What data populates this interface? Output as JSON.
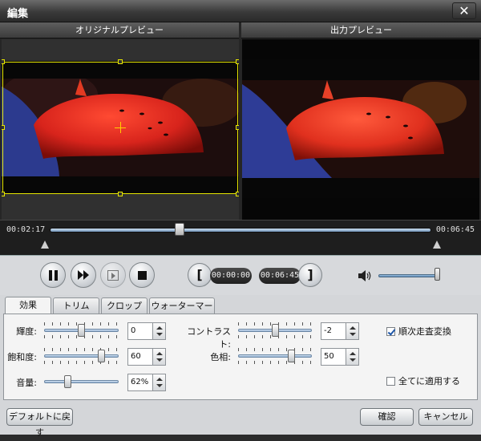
{
  "window": {
    "title": "編集",
    "close_label": "✕"
  },
  "preview": {
    "original_label": "オリジナルプレビュー",
    "output_label": "出力プレビュー"
  },
  "timeline": {
    "start_time": "00:02:17",
    "end_time": "00:06:45",
    "position_fraction": 0.34
  },
  "playback": {
    "trim_start": "00:00:00",
    "trim_end": "00:06:45",
    "volume_fraction": 0.95,
    "open_bracket": "[",
    "close_bracket": "]"
  },
  "tabs": [
    {
      "label": "効果",
      "active": true
    },
    {
      "label": "トリム",
      "active": false
    },
    {
      "label": "クロップ",
      "active": false
    },
    {
      "label": "ウォーターマーク",
      "active": false
    }
  ],
  "effects": {
    "brightness": {
      "label": "輝度:",
      "value": "0",
      "fraction": 0.5
    },
    "saturation": {
      "label": "飽和度:",
      "value": "60",
      "fraction": 0.8
    },
    "volume": {
      "label": "音量:",
      "value": "62%",
      "fraction": 0.3
    },
    "contrast": {
      "label": "コントラスト:",
      "value": "-2",
      "fraction": 0.5
    },
    "hue": {
      "label": "色相:",
      "value": "50",
      "fraction": 0.75
    },
    "deinterlace": {
      "label": "順次走査変換",
      "checked": true
    },
    "apply_all": {
      "label": "全てに適用する",
      "checked": false
    }
  },
  "footer": {
    "reset_label": "デフォルトに戻す",
    "ok_label": "確認",
    "cancel_label": "キャンセル"
  },
  "colors": {
    "crop_border": "#e6e600",
    "umbrella_red": "#d8241c",
    "accent_blue": "#1d56a8"
  }
}
